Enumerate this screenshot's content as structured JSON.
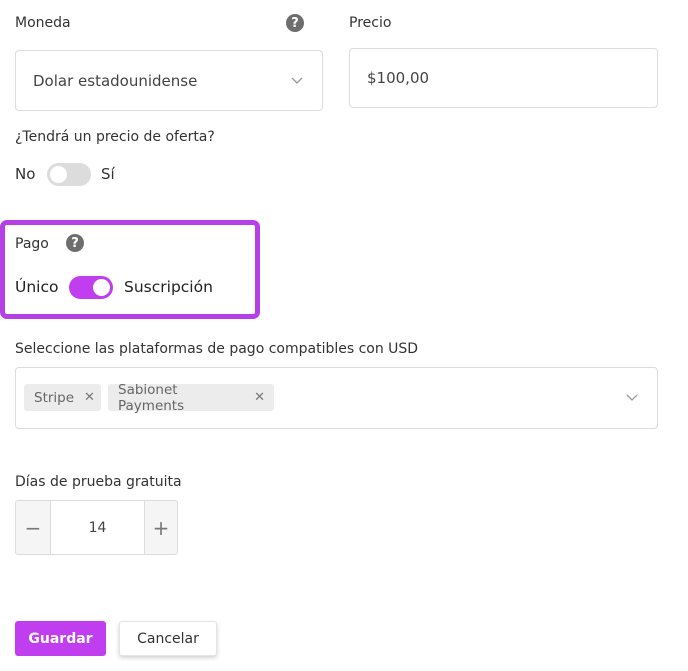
{
  "moneda": {
    "label": "Moneda",
    "selected": "Dolar estadounidense"
  },
  "precio": {
    "label": "Precio",
    "value": "$100,00"
  },
  "oferta": {
    "question": "¿Tendrá un precio de oferta?",
    "off_label": "No",
    "on_label": "Sí",
    "enabled": false
  },
  "pago": {
    "label": "Pago",
    "left_label": "Único",
    "right_label": "Suscripción",
    "subscription": true
  },
  "plataformas": {
    "label": "Seleccione las plataformas de pago compatibles con USD",
    "chips": [
      "Stripe",
      "Sabionet Payments"
    ],
    "remove_glyph": "✕"
  },
  "prueba": {
    "label": "Días de prueba gratuita",
    "value": "14",
    "minus": "−",
    "plus": "+"
  },
  "actions": {
    "save": "Guardar",
    "cancel": "Cancelar"
  },
  "help_glyph": "?",
  "colors": {
    "accent": "#c13ef0",
    "toggle_off": "#dcdcdc",
    "highlight_border": "#b540e6"
  },
  "icons": {
    "help": "question-circle-icon",
    "dropdown": "chevron-down-icon",
    "remove": "close-icon"
  }
}
